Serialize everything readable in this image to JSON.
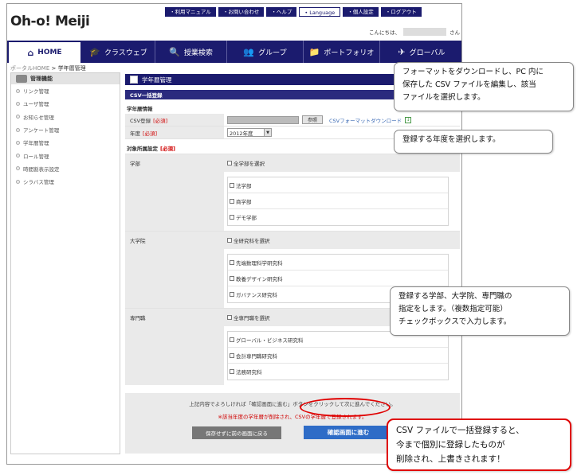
{
  "header": {
    "logo": "Oh-o! Meiji",
    "util_links": [
      "・利用マニュアル",
      "・お問い合わせ",
      "・ヘルプ",
      "• Language",
      "・個人設定",
      "・ログアウト"
    ],
    "greeting": "こんにちは、",
    "greeting_suffix": "さん"
  },
  "gnav": {
    "items": [
      {
        "icon": "home-icon",
        "glyph": "⌂",
        "label": "HOME"
      },
      {
        "icon": "mortarboard-icon",
        "glyph": "🎓",
        "label": "クラスウェブ"
      },
      {
        "icon": "search-icon",
        "glyph": "🔍",
        "label": "授業検索"
      },
      {
        "icon": "group-icon",
        "glyph": "👥",
        "label": "グループ"
      },
      {
        "icon": "folder-icon",
        "glyph": "📁",
        "label": "ポートフォリオ"
      },
      {
        "icon": "plane-icon",
        "glyph": "✈",
        "label": "グローバル"
      }
    ]
  },
  "breadcrumb": {
    "home": "ポータルHOME",
    "sep": " > ",
    "current": "学年暦管理"
  },
  "sidebar": {
    "title": "管理機能",
    "items": [
      "リンク管理",
      "ユーザ管理",
      "お知らせ管理",
      "アンケート管理",
      "学年暦管理",
      "ロール管理",
      "時間割表示設定",
      "シラバス管理"
    ]
  },
  "main": {
    "page_title": "学年暦管理",
    "section_title": "CSV一括登録",
    "info_label": "学年暦情報",
    "required": "[必須]",
    "csv_label": "CSV登録",
    "browse": "参照",
    "csv_link": "CSVフォーマットダウンロード",
    "year_label": "年度",
    "year_value": "2012年度",
    "target_label": "対象所属設定",
    "groups": [
      {
        "name": "学部",
        "all": "全学部を選択",
        "items": [
          "法学部",
          "商学部",
          "デモ学部"
        ]
      },
      {
        "name": "大学院",
        "all": "全研究科を選択",
        "items": [
          "先端数理科学研究科",
          "教養デザイン研究科",
          "ガバナンス研究科"
        ]
      },
      {
        "name": "専門職",
        "all": "全専門職を選択",
        "items": [
          "グローバル・ビジネス研究科",
          "会計専門職研究科",
          "法務研究科"
        ]
      }
    ],
    "footer_text": "上記内容でよろしければ「確認画面に進む」ボタンをクリックして次に進んでください。",
    "footer_warning": "※該当年度の学年暦が削除され、CSVの学年暦で登録されます。",
    "back_button": "保存せずに前の画面に戻る",
    "confirm_button": "確認画面に進む"
  },
  "callouts": {
    "c1": [
      "フォーマットをダウンロードし、PC 内に",
      "保存した CSV ファイルを編集し、該当",
      "ファイルを選択します。"
    ],
    "c2": [
      "登録する年度を選択します。"
    ],
    "c3": [
      "登録する学部、大学院、専門職の",
      "指定をします。（複数指定可能）",
      "チェックボックスで入力します。"
    ],
    "c4": [
      "CSV ファイルで一括登録すると、",
      "今まで個別に登録したものが",
      "削除され、上書きされます！"
    ]
  },
  "colors": {
    "navy": "#1b1b6e",
    "button_blue": "#2e6cc7",
    "alert_red": "#e00000"
  }
}
